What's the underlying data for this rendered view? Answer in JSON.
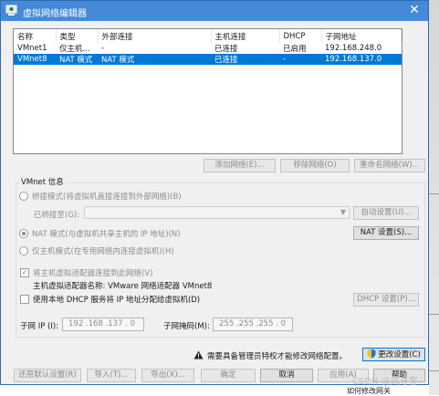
{
  "window": {
    "title": "虚拟网络编辑器",
    "close_glyph": "✕"
  },
  "network_table": {
    "headers": [
      "名称",
      "类型",
      "外部连接",
      "主机连接",
      "DHCP",
      "子网地址"
    ],
    "rows": [
      [
        "VMnet1",
        "仅主机...",
        "-",
        "已连接",
        "已启用",
        "192.168.248.0"
      ],
      [
        "VMnet8",
        "NAT 模式",
        "NAT 模式",
        "已连接",
        "-",
        "192.168.137.0"
      ]
    ],
    "selected_row": 1
  },
  "list_buttons": {
    "add": "添加网络(E)...",
    "remove": "移除网络(O)",
    "rename": "重命名网络(W)..."
  },
  "vmnet_info": {
    "title": "VMnet 信息",
    "bridged_label": "桥接模式(将虚拟机直接连接到外部网络)(B)",
    "bridged_to_label": "已桥接至(G):",
    "bridged_to_value": "",
    "auto_settings": "自动设置(U)...",
    "nat_label": "NAT 模式(与虚拟机共享主机的 IP 地址)(N)",
    "nat_settings": "NAT 设置(S)...",
    "hostonly_label": "仅主机模式(在专用网络内连接虚拟机)(H)",
    "connect_adapter_label": "将主机虚拟适配器连接到此网络(V)",
    "adapter_name_label": "主机虚拟适配器名称: VMware 网络适配器 VMnet8",
    "dhcp_label": "使用本地 DHCP 服务将 IP 地址分配给虚拟机(D)",
    "dhcp_settings": "DHCP 设置(P)...",
    "subnet_ip_label": "子网 IP (I):",
    "subnet_ip_value": "192 .168 .137 . 0",
    "subnet_mask_label": "子网掩码(M):",
    "subnet_mask_value": "255 .255 .255 . 0"
  },
  "admin_notice": "需要具备管理员特权才能修改网络配置。",
  "change_settings": "更改设置(C)",
  "bottom_buttons": {
    "restore": "还原默认设置(R)",
    "import": "导入(T)...",
    "export": "导出(X)...",
    "ok": "确定",
    "cancel": "取消",
    "apply": "应用(A)",
    "help": "帮助"
  },
  "watermark": "CSDN @风寻客",
  "background_text": "如何修改网关"
}
